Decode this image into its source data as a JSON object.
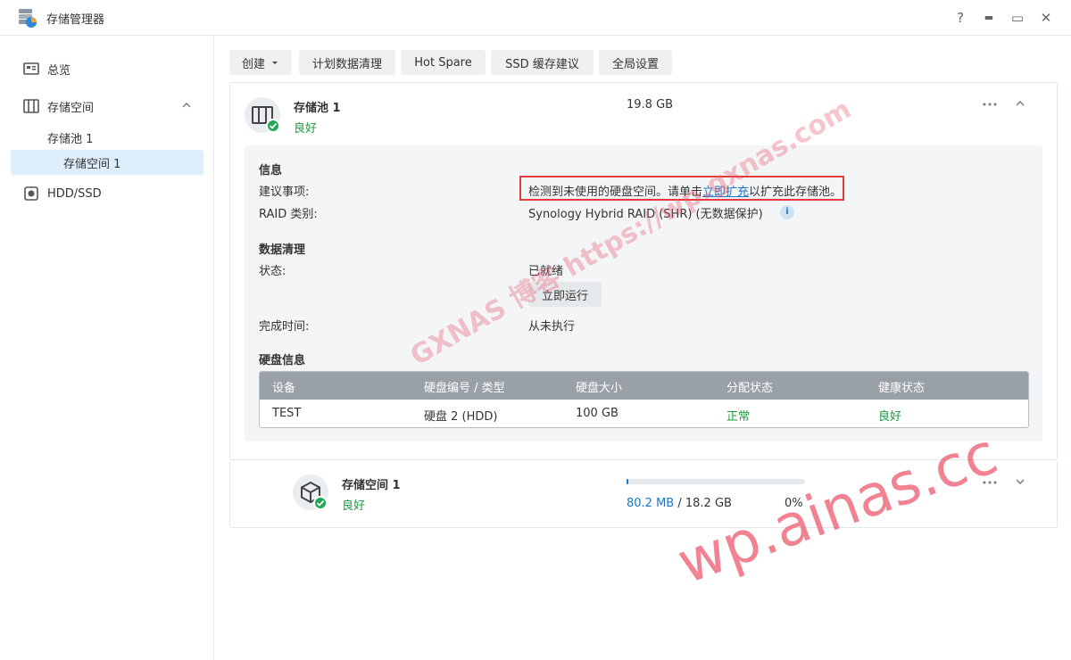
{
  "window": {
    "title": "存储管理器",
    "help": "?",
    "minimize": "▬",
    "maximize": "▭",
    "close": "✕"
  },
  "sidebar": {
    "items": [
      {
        "label": "总览",
        "icon": "overview-icon"
      },
      {
        "label": "存储空间",
        "icon": "storage-icon"
      },
      {
        "label": "存储池 1"
      },
      {
        "label": "存储空间 1"
      },
      {
        "label": "HDD/SSD",
        "icon": "disk-icon"
      }
    ]
  },
  "toolbar": {
    "create": "创建",
    "schedule": "计划数据清理",
    "hotspare": "Hot Spare",
    "ssd": "SSD 缓存建议",
    "global": "全局设置"
  },
  "pool": {
    "name": "存储池 1",
    "status": "良好",
    "size": "19.8 GB",
    "info": {
      "title": "信息",
      "suggest_label": "建议事项:",
      "suggest_pre": "检测到未使用的硬盘空间。请单击",
      "suggest_link": "立即扩充",
      "suggest_post": "以扩充此存储池。",
      "raid_label": "RAID 类别:",
      "raid_value": "Synology Hybrid RAID (SHR) (无数据保护)"
    },
    "scrub": {
      "title": "数据清理",
      "status_label": "状态:",
      "status_value": "已就绪",
      "run_button": "立即运行",
      "done_label": "完成时间:",
      "done_value": "从未执行"
    },
    "disks": {
      "title": "硬盘信息",
      "columns": [
        "设备",
        "硬盘编号 / 类型",
        "硬盘大小",
        "分配状态",
        "健康状态"
      ],
      "rows": [
        [
          "TEST",
          "硬盘 2 (HDD)",
          "100 GB",
          "正常",
          "良好"
        ]
      ]
    }
  },
  "volume": {
    "name": "存储空间 1",
    "status": "良好",
    "used": "80.2 MB",
    "sep": " / ",
    "total": "18.2 GB",
    "percent": "0%",
    "usage_fraction": 0.004
  },
  "watermarks": {
    "diag": "GXNAS 博客 https://wp.gxnas.com",
    "corner": "wp.ainas.cc"
  },
  "colors": {
    "accent": "#1b74c5",
    "good": "#1d9a3f",
    "highlight": "#e33b3b"
  }
}
